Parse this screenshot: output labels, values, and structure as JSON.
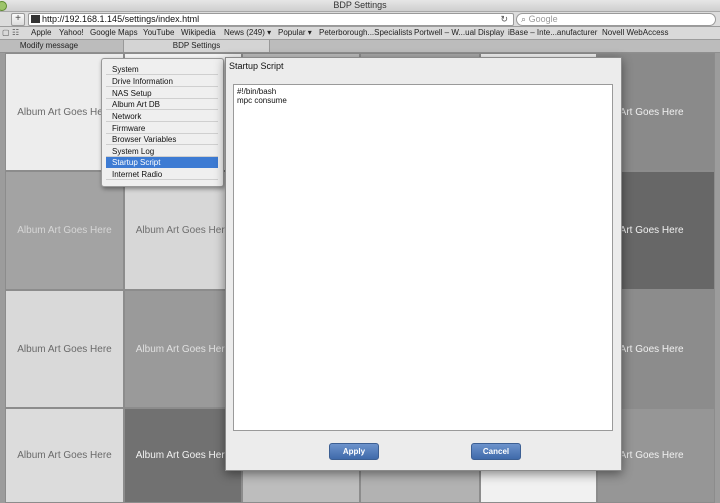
{
  "window": {
    "title": "BDP Settings"
  },
  "toolbar": {
    "add_button": "+",
    "url": "http://192.168.1.145/settings/index.html",
    "reload": "↻",
    "search_placeholder": "Google",
    "search_icon": "⌕"
  },
  "bookmarks": {
    "items": [
      "Apple",
      "Yahoo!",
      "Google Maps",
      "YouTube",
      "Wikipedia",
      "News (249) ▾",
      "Popular ▾",
      "Peterborough...Specialists",
      "Portwell – W...ual Display",
      "iBase – Inte...anufacturer",
      "Novell WebAccess"
    ]
  },
  "tabs": [
    {
      "label": "Modify message"
    },
    {
      "label": "BDP Settings"
    }
  ],
  "tiles": {
    "label": "Album Art Goes Here",
    "cut_label": "bum Art Goes Here"
  },
  "menu": {
    "items": [
      "System",
      "Drive Information",
      "NAS Setup",
      "Album Art DB",
      "Network",
      "Firmware",
      "Browser Variables",
      "System Log",
      "Startup Script",
      "Internet Radio"
    ],
    "selected": "Startup Script"
  },
  "dialog": {
    "title": "Startup Script",
    "script": "#!/bin/bash\nmpc consume",
    "apply_label": "Apply",
    "cancel_label": "Cancel"
  },
  "colors": {
    "accent": "#3d7bd3",
    "button": "#4f78b6"
  }
}
